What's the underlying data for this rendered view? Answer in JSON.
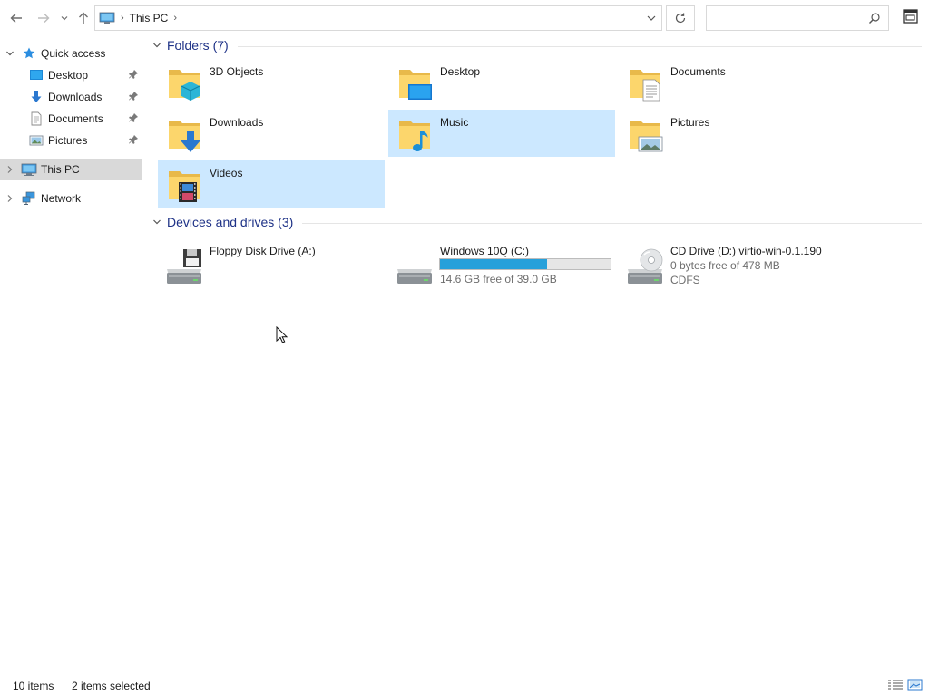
{
  "window": {
    "title": "This PC"
  },
  "address_bar": {
    "breadcrumb": "This PC",
    "icon": "computer-icon"
  },
  "search": {
    "placeholder": "",
    "value": ""
  },
  "sidebar": {
    "quick_access": {
      "label": "Quick access",
      "icon": "star-icon"
    },
    "pinned": [
      {
        "label": "Desktop",
        "icon": "desktop-icon"
      },
      {
        "label": "Downloads",
        "icon": "downloads-icon"
      },
      {
        "label": "Documents",
        "icon": "documents-icon"
      },
      {
        "label": "Pictures",
        "icon": "pictures-icon"
      }
    ],
    "this_pc": {
      "label": "This PC",
      "icon": "computer-icon",
      "selected": true
    },
    "network": {
      "label": "Network",
      "icon": "network-icon"
    }
  },
  "folders_group": {
    "title": "Folders (7)",
    "items": [
      {
        "name": "3D Objects",
        "icon": "3d-objects-folder-icon",
        "selected": false
      },
      {
        "name": "Desktop",
        "icon": "desktop-folder-icon",
        "selected": false
      },
      {
        "name": "Documents",
        "icon": "documents-folder-icon",
        "selected": false
      },
      {
        "name": "Downloads",
        "icon": "downloads-folder-icon",
        "selected": false
      },
      {
        "name": "Music",
        "icon": "music-folder-icon",
        "selected": true
      },
      {
        "name": "Pictures",
        "icon": "pictures-folder-icon",
        "selected": false
      },
      {
        "name": "Videos",
        "icon": "videos-folder-icon",
        "selected": true
      }
    ]
  },
  "drives_group": {
    "title": "Devices and drives (3)",
    "items": [
      {
        "name": "Floppy Disk Drive (A:)",
        "icon": "floppy-drive-icon"
      },
      {
        "name": "Windows 10Q (C:)",
        "icon": "hard-drive-icon",
        "free_text": "14.6 GB free of 39.0 GB",
        "used_fraction": 0.626
      },
      {
        "name": "CD Drive (D:) virtio-win-0.1.190",
        "icon": "cd-drive-icon",
        "free_text": "0 bytes free of 478 MB",
        "filesystem": "CDFS"
      }
    ]
  },
  "status_bar": {
    "item_count": "10 items",
    "selection": "2 items selected"
  },
  "colors": {
    "selection": "#cce8ff",
    "group_title": "#1e3287",
    "drive_bar": "#26a0da",
    "sidebar_selected": "#d9d9d9"
  }
}
